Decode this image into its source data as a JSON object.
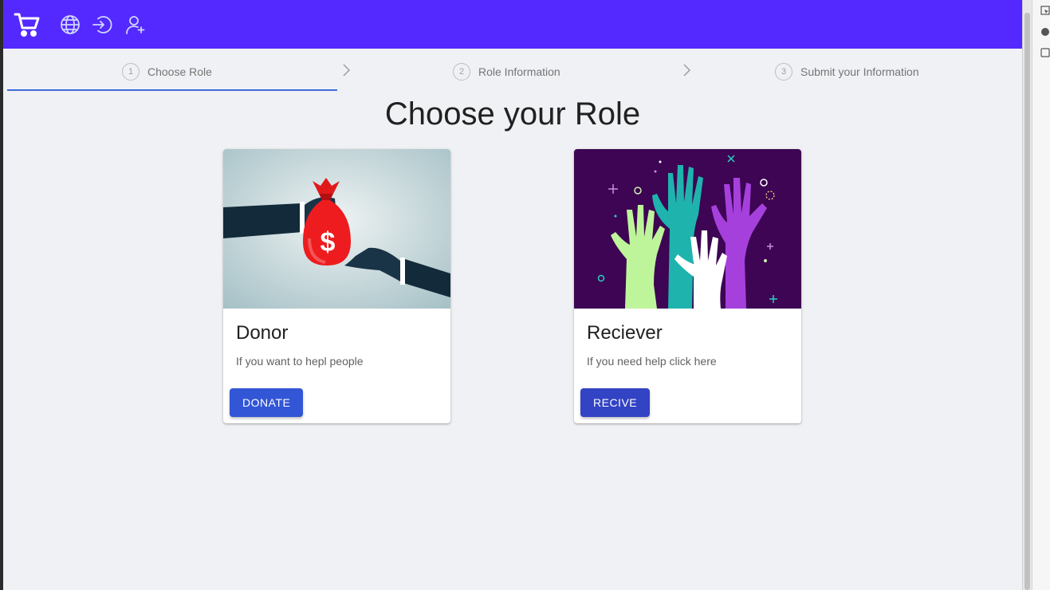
{
  "header": {
    "icons": [
      "cart-icon",
      "globe-icon",
      "login-icon",
      "add-user-icon"
    ],
    "background": "#5429ff"
  },
  "stepper": {
    "steps": [
      {
        "number": "1",
        "label": "Choose Role",
        "active": true
      },
      {
        "number": "2",
        "label": "Role Information",
        "active": false
      },
      {
        "number": "3",
        "label": "Submit your Information",
        "active": false
      }
    ],
    "active_underline_color": "#3f6bdc"
  },
  "main": {
    "title": "Choose your Role"
  },
  "cards": [
    {
      "title": "Donor",
      "text": "If you want to hepl people",
      "button": "DONATE",
      "button_color": "#3256d6",
      "image": "hand-giving-money-bag"
    },
    {
      "title": "Reciever",
      "text": "If you need help click here",
      "button": "RECIVE",
      "button_color": "#3243c4",
      "image": "raised-hands"
    }
  ]
}
